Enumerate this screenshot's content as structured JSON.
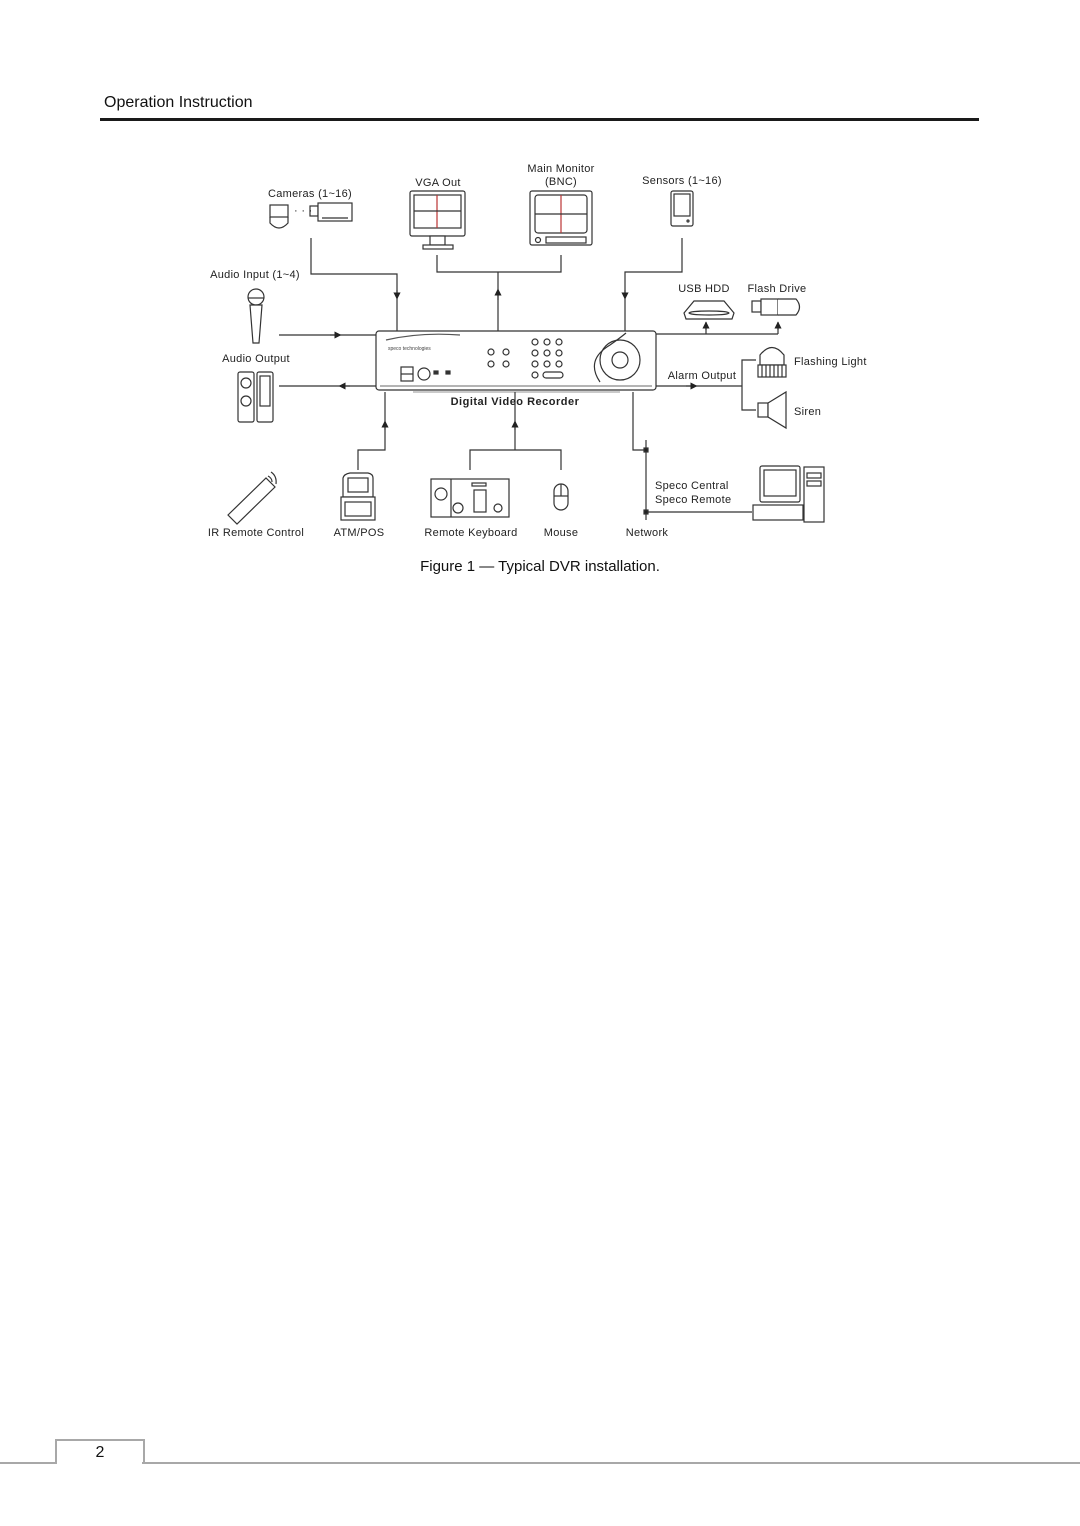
{
  "header": {
    "title": "Operation Instruction"
  },
  "diagram": {
    "dvr_label": "Digital Video Recorder",
    "dvr_brand": "speco technologies",
    "devices": {
      "cameras": "Cameras  (1~16)",
      "vga_out": "VGA Out",
      "main_monitor_line1": "Main Monitor",
      "main_monitor_line2": "(BNC)",
      "sensors": "Sensors (1~16)",
      "audio_input": "Audio Input (1~4)",
      "audio_output": "Audio Output",
      "usb_hdd": "USB HDD",
      "flash_drive": "Flash Drive",
      "alarm_output": "Alarm Output",
      "flashing_light": "Flashing Light",
      "siren": "Siren",
      "ir_remote": "IR Remote Control",
      "atm_pos": "ATM/POS",
      "remote_keyboard": "Remote Keyboard",
      "mouse": "Mouse",
      "network": "Network",
      "speco_central": "Speco Central",
      "speco_remote": "Speco Remote"
    }
  },
  "caption": "Figure 1 — Typical DVR installation.",
  "footer": {
    "page_number": "2"
  }
}
